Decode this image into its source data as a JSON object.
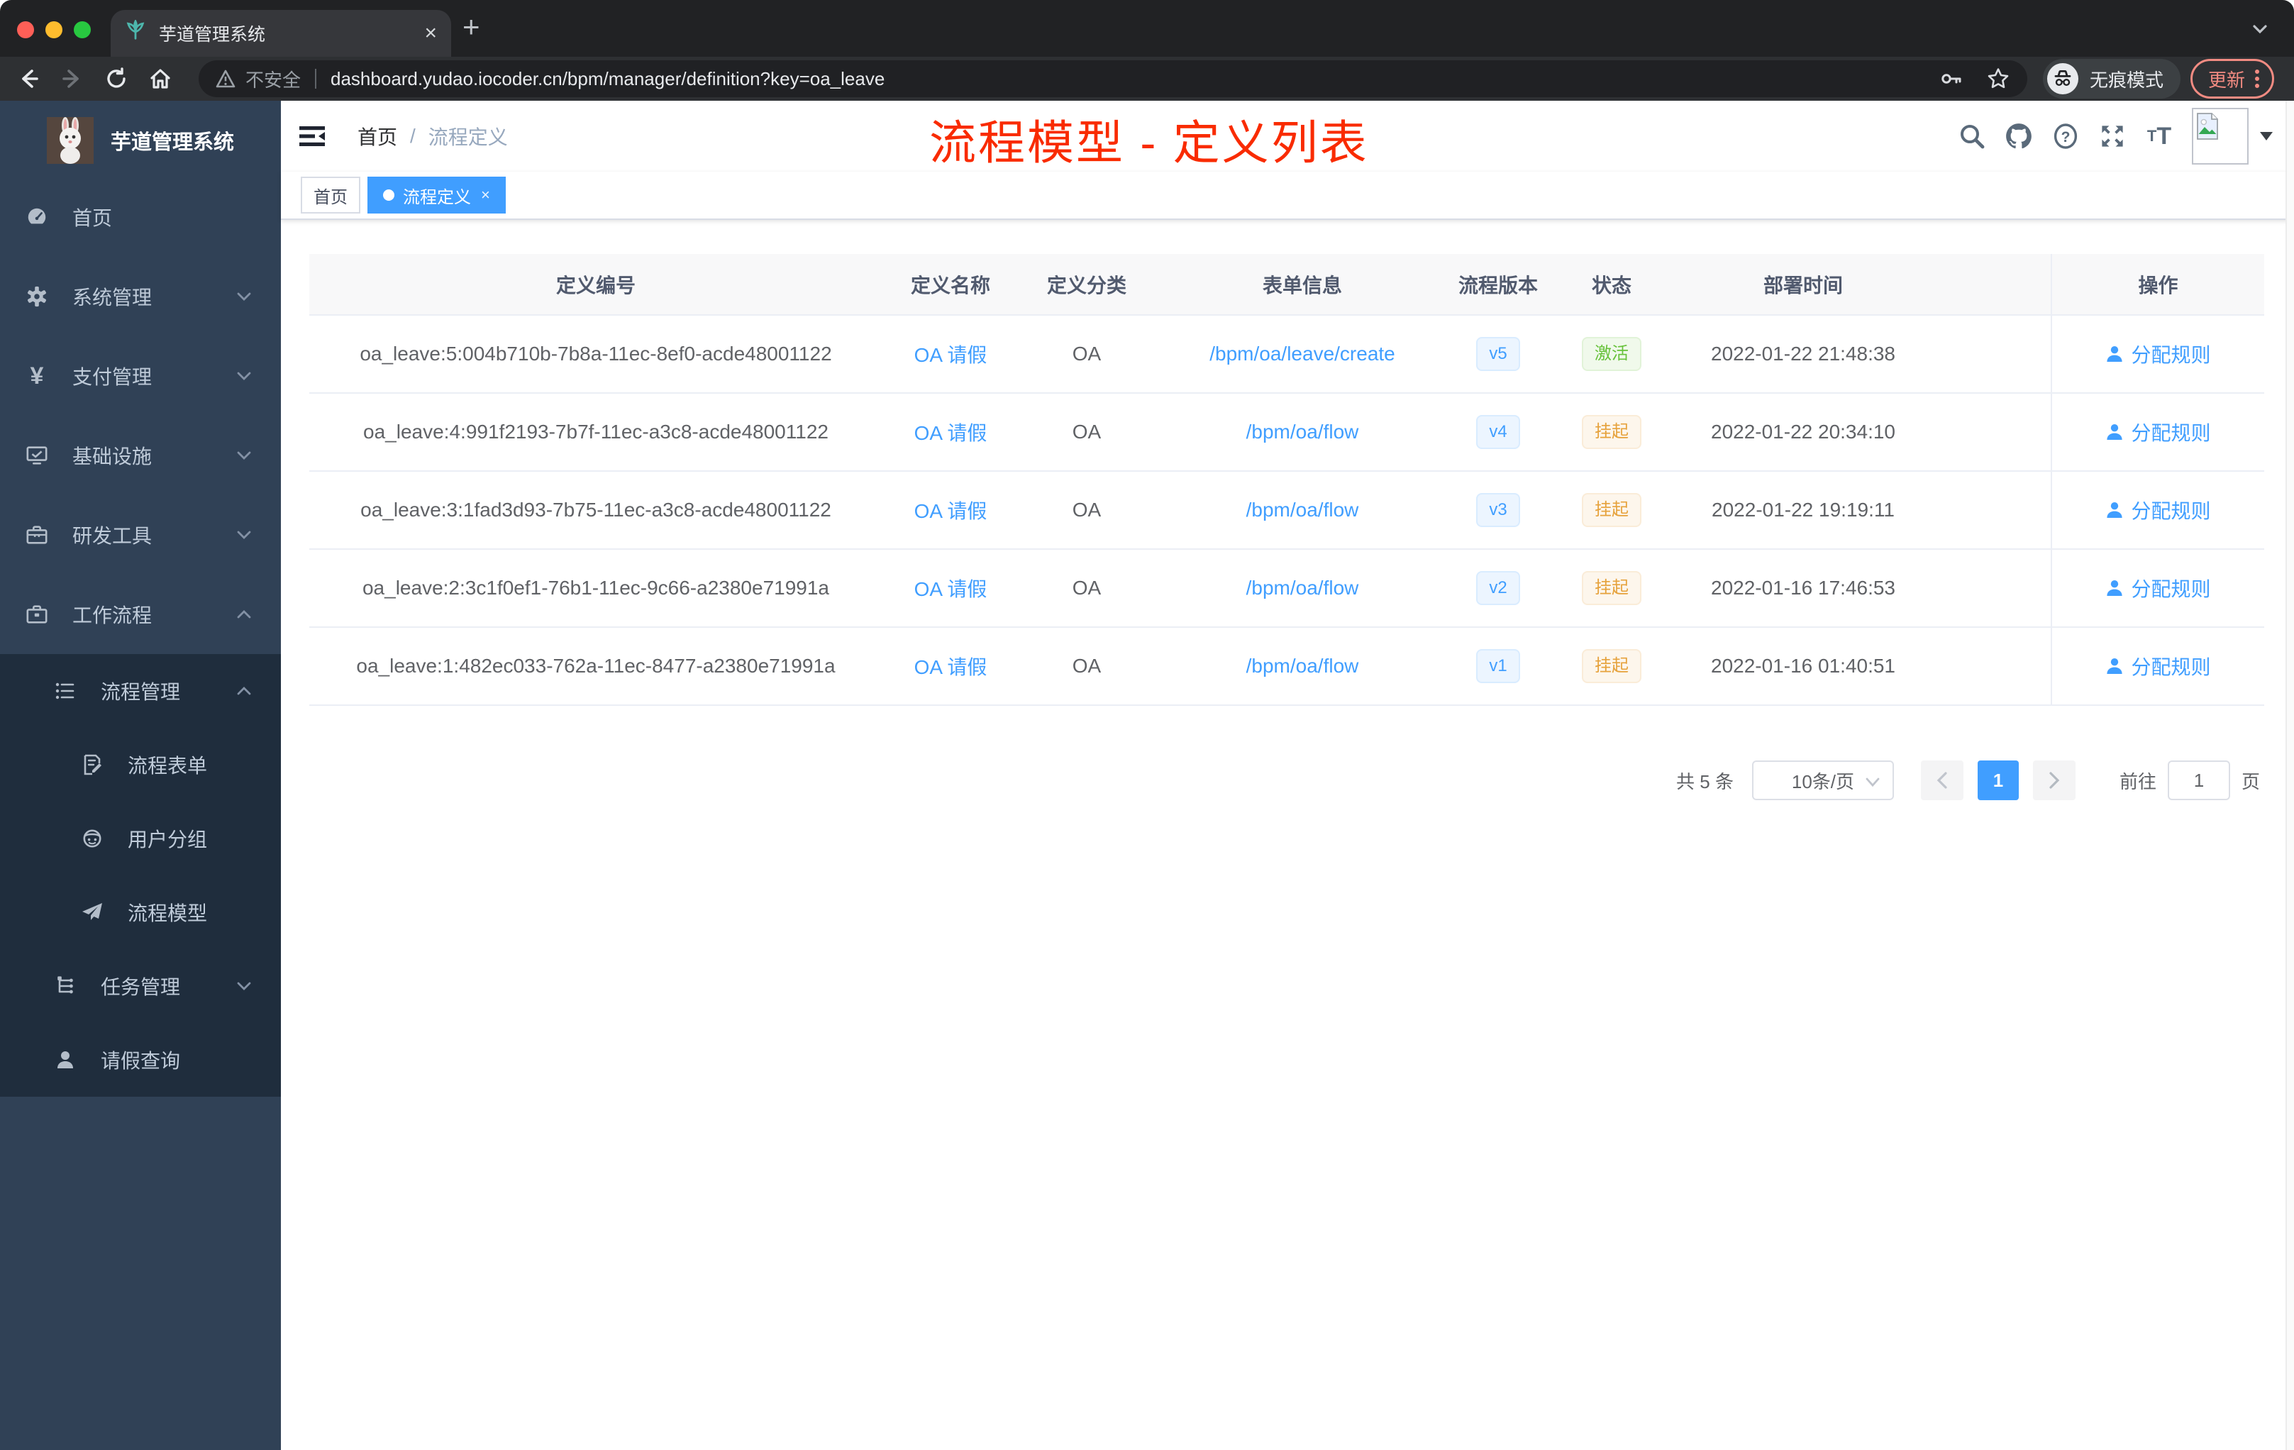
{
  "browser": {
    "tab": {
      "title": "芋道管理系统",
      "close_label": "×",
      "new_tab_label": "+"
    },
    "toolbar": {
      "security_label": "不安全",
      "url": "dashboard.yudao.iocoder.cn/bpm/manager/definition?key=oa_leave",
      "incognito_label": "无痕模式",
      "update_label": "更新"
    }
  },
  "sidebar": {
    "logo_title": "芋道管理系统",
    "menu": [
      {
        "label": "首页"
      },
      {
        "label": "系统管理"
      },
      {
        "label": "支付管理"
      },
      {
        "label": "基础设施"
      },
      {
        "label": "研发工具"
      },
      {
        "label": "工作流程"
      }
    ],
    "submenu": [
      {
        "label": "流程管理"
      },
      {
        "label": "流程表单"
      },
      {
        "label": "用户分组"
      },
      {
        "label": "流程模型"
      },
      {
        "label": "任务管理"
      },
      {
        "label": "请假查询"
      }
    ]
  },
  "header": {
    "breadcrumb_home": "首页",
    "breadcrumb_current": "流程定义",
    "annotation_title": "流程模型 - 定义列表",
    "annotation_color": "#f92b00"
  },
  "tags": [
    {
      "label": "首页",
      "active": false
    },
    {
      "label": "流程定义",
      "active": true,
      "close_label": "×"
    }
  ],
  "table": {
    "columns": [
      "定义编号",
      "定义名称",
      "定义分类",
      "表单信息",
      "流程版本",
      "状态",
      "部署时间",
      "操作"
    ],
    "action_label": "分配规则",
    "rows": [
      {
        "id": "oa_leave:5:004b710b-7b8a-11ec-8ef0-acde48001122",
        "name": "OA 请假",
        "category": "OA",
        "form": "/bpm/oa/leave/create",
        "version": "v5",
        "status": "激活",
        "status_type": "success",
        "deploy_time": "2022-01-22 21:48:38"
      },
      {
        "id": "oa_leave:4:991f2193-7b7f-11ec-a3c8-acde48001122",
        "name": "OA 请假",
        "category": "OA",
        "form": "/bpm/oa/flow",
        "version": "v4",
        "status": "挂起",
        "status_type": "warning",
        "deploy_time": "2022-01-22 20:34:10"
      },
      {
        "id": "oa_leave:3:1fad3d93-7b75-11ec-a3c8-acde48001122",
        "name": "OA 请假",
        "category": "OA",
        "form": "/bpm/oa/flow",
        "version": "v3",
        "status": "挂起",
        "status_type": "warning",
        "deploy_time": "2022-01-22 19:19:11"
      },
      {
        "id": "oa_leave:2:3c1f0ef1-76b1-11ec-9c66-a2380e71991a",
        "name": "OA 请假",
        "category": "OA",
        "form": "/bpm/oa/flow",
        "version": "v2",
        "status": "挂起",
        "status_type": "warning",
        "deploy_time": "2022-01-16 17:46:53"
      },
      {
        "id": "oa_leave:1:482ec033-762a-11ec-8477-a2380e71991a",
        "name": "OA 请假",
        "category": "OA",
        "form": "/bpm/oa/flow",
        "version": "v1",
        "status": "挂起",
        "status_type": "warning",
        "deploy_time": "2022-01-16 01:40:51"
      }
    ]
  },
  "pagination": {
    "total": "共 5 条",
    "page_size": "10条/页",
    "current": "1",
    "goto_label": "前往",
    "goto_value": "1",
    "page_label": "页"
  }
}
